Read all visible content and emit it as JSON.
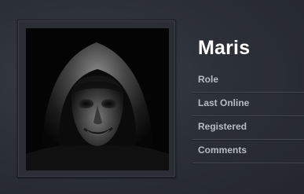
{
  "profile": {
    "name": "Maris",
    "avatar": "hooded-figure-portrait"
  },
  "fields": [
    {
      "label": "Role"
    },
    {
      "label": "Last Online"
    },
    {
      "label": "Registered"
    },
    {
      "label": "Comments"
    }
  ]
}
